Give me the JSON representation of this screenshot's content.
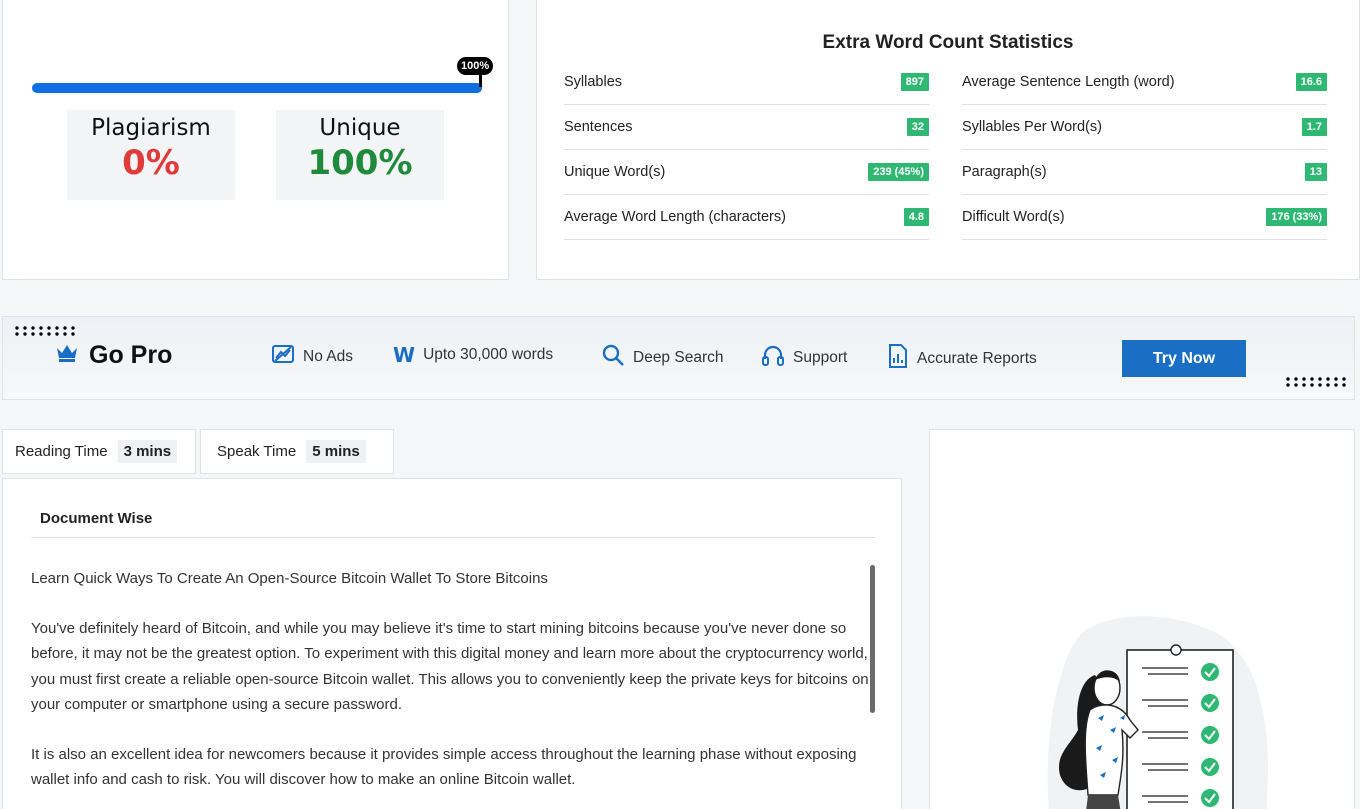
{
  "result": {
    "progress_percent": 100,
    "progress_label": "100%",
    "plagiarism_label": "Plagiarism",
    "plagiarism_value": "0%",
    "unique_label": "Unique",
    "unique_value": "100%"
  },
  "stats": {
    "title": "Extra Word Count Statistics",
    "left": [
      {
        "label": "Syllables",
        "value": "897"
      },
      {
        "label": "Sentences",
        "value": "32"
      },
      {
        "label": "Unique Word(s)",
        "value": "239 (45%)"
      },
      {
        "label": "Average Word Length (characters)",
        "value": "4.8"
      }
    ],
    "right": [
      {
        "label": "Average Sentence Length (word)",
        "value": "16.6"
      },
      {
        "label": "Syllables Per Word(s)",
        "value": "1.7"
      },
      {
        "label": "Paragraph(s)",
        "value": "13"
      },
      {
        "label": "Difficult Word(s)",
        "value": "176 (33%)"
      }
    ]
  },
  "gopro": {
    "title": "Go Pro",
    "features": {
      "no_ads": "No Ads",
      "words": "Upto 30,000 words",
      "deep_search": "Deep Search",
      "support": "Support",
      "reports": "Accurate Reports"
    },
    "w_glyph": "W",
    "cta": "Try Now"
  },
  "times": {
    "reading_label": "Reading Time",
    "reading_value": "3 mins",
    "speak_label": "Speak Time",
    "speak_value": "5 mins"
  },
  "document": {
    "heading": "Document Wise",
    "paragraphs": [
      "Learn Quick Ways To Create An Open-Source Bitcoin Wallet To Store Bitcoins",
      "You've definitely heard of Bitcoin, and while you may believe it's time to start mining bitcoins because you've never done so before, it may not be the greatest option. To experiment with this digital money and learn more about the cryptocurrency world, you must first create a reliable open-source Bitcoin wallet. This allows you to conveniently keep the private keys for bitcoins on your computer or smartphone using a secure password.",
      "It is also an excellent idea for newcomers because it provides simple access throughout the learning phase without exposing wallet info and cash to risk. You will discover how to make an online Bitcoin wallet."
    ]
  },
  "colors": {
    "accent_blue": "#1a6ec4",
    "plagiarism_red": "#e03b3b",
    "unique_green": "#1f8a3c",
    "badge_green": "#2fb873"
  }
}
